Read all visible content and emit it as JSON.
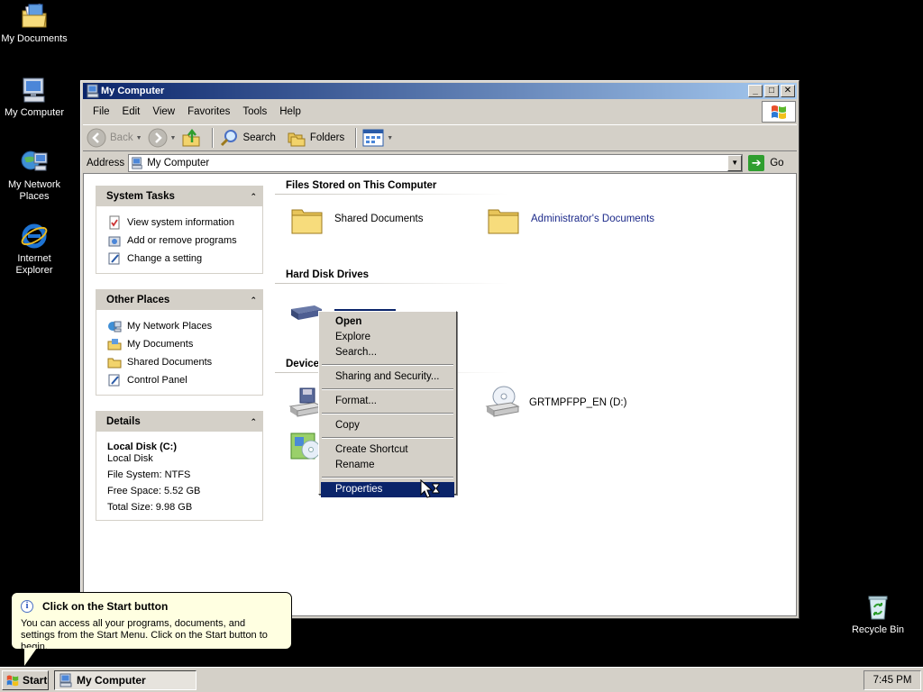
{
  "desktop": {
    "icons": [
      {
        "label": "My Documents",
        "icon": "my-documents-icon"
      },
      {
        "label": "My Computer",
        "icon": "my-computer-icon"
      },
      {
        "label": "My Network Places",
        "icon": "network-places-icon"
      },
      {
        "label": "Internet Explorer",
        "icon": "internet-explorer-icon"
      },
      {
        "label": "Recycle Bin",
        "icon": "recycle-bin-icon"
      }
    ]
  },
  "window": {
    "title": "My Computer",
    "menu": [
      "File",
      "Edit",
      "View",
      "Favorites",
      "Tools",
      "Help"
    ],
    "toolbar": {
      "back": "Back",
      "search": "Search",
      "folders": "Folders"
    },
    "address": {
      "label": "Address",
      "value": "My Computer",
      "go": "Go"
    }
  },
  "left_panel": {
    "system_tasks": {
      "title": "System Tasks",
      "items": [
        "View system information",
        "Add or remove programs",
        "Change a setting"
      ]
    },
    "other_places": {
      "title": "Other Places",
      "items": [
        "My Network Places",
        "My Documents",
        "Shared Documents",
        "Control Panel"
      ]
    },
    "details": {
      "title": "Details",
      "name": "Local Disk (C:)",
      "type": "Local Disk",
      "file_system": "File System: NTFS",
      "free_space": "Free Space: 5.52 GB",
      "total_size": "Total Size: 9.98 GB"
    }
  },
  "main": {
    "files_stored": {
      "title": "Files Stored on This Computer",
      "items": [
        "Shared Documents",
        "Administrator's Documents"
      ]
    },
    "hard_disks": {
      "title": "Hard Disk Drives"
    },
    "devices": {
      "title": "Device",
      "cd_drive": "GRTMPFPP_EN (D:)"
    }
  },
  "context_menu": {
    "items": [
      "Open",
      "Explore",
      "Search...",
      "Sharing and Security...",
      "Format...",
      "Copy",
      "Create Shortcut",
      "Rename",
      "Properties"
    ],
    "selected": "Properties"
  },
  "balloon": {
    "title": "Click on the Start button",
    "body": "You can access all your programs, documents, and settings from the Start Menu. Click on the Start button to begin."
  },
  "taskbar": {
    "start": "Start",
    "task": "My Computer",
    "clock": "7:45 PM"
  },
  "colors": {
    "title_active": "#0a246a",
    "selection": "#0a246a",
    "face": "#d4d0c8",
    "tooltip_bg": "#ffffe1",
    "link": "#1c2a8a"
  }
}
